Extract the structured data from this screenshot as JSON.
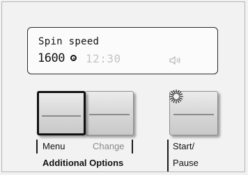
{
  "display": {
    "program_label": "Spin speed",
    "spin_value": "1600",
    "time_value": "12:30",
    "spin_icon": "spin-icon",
    "sound_icon": "speaker-icon"
  },
  "buttons": {
    "menu_label": "Menu",
    "change_label": "Change",
    "group_label": "Additional Options",
    "start_line1": "Start/",
    "start_line2": "Pause",
    "start_indicator_icon": "light-burst-icon"
  },
  "colors": {
    "display_text": "#111111",
    "time_dimmed": "#c4c4c4",
    "change_label_dimmed": "#8a8a8a"
  }
}
